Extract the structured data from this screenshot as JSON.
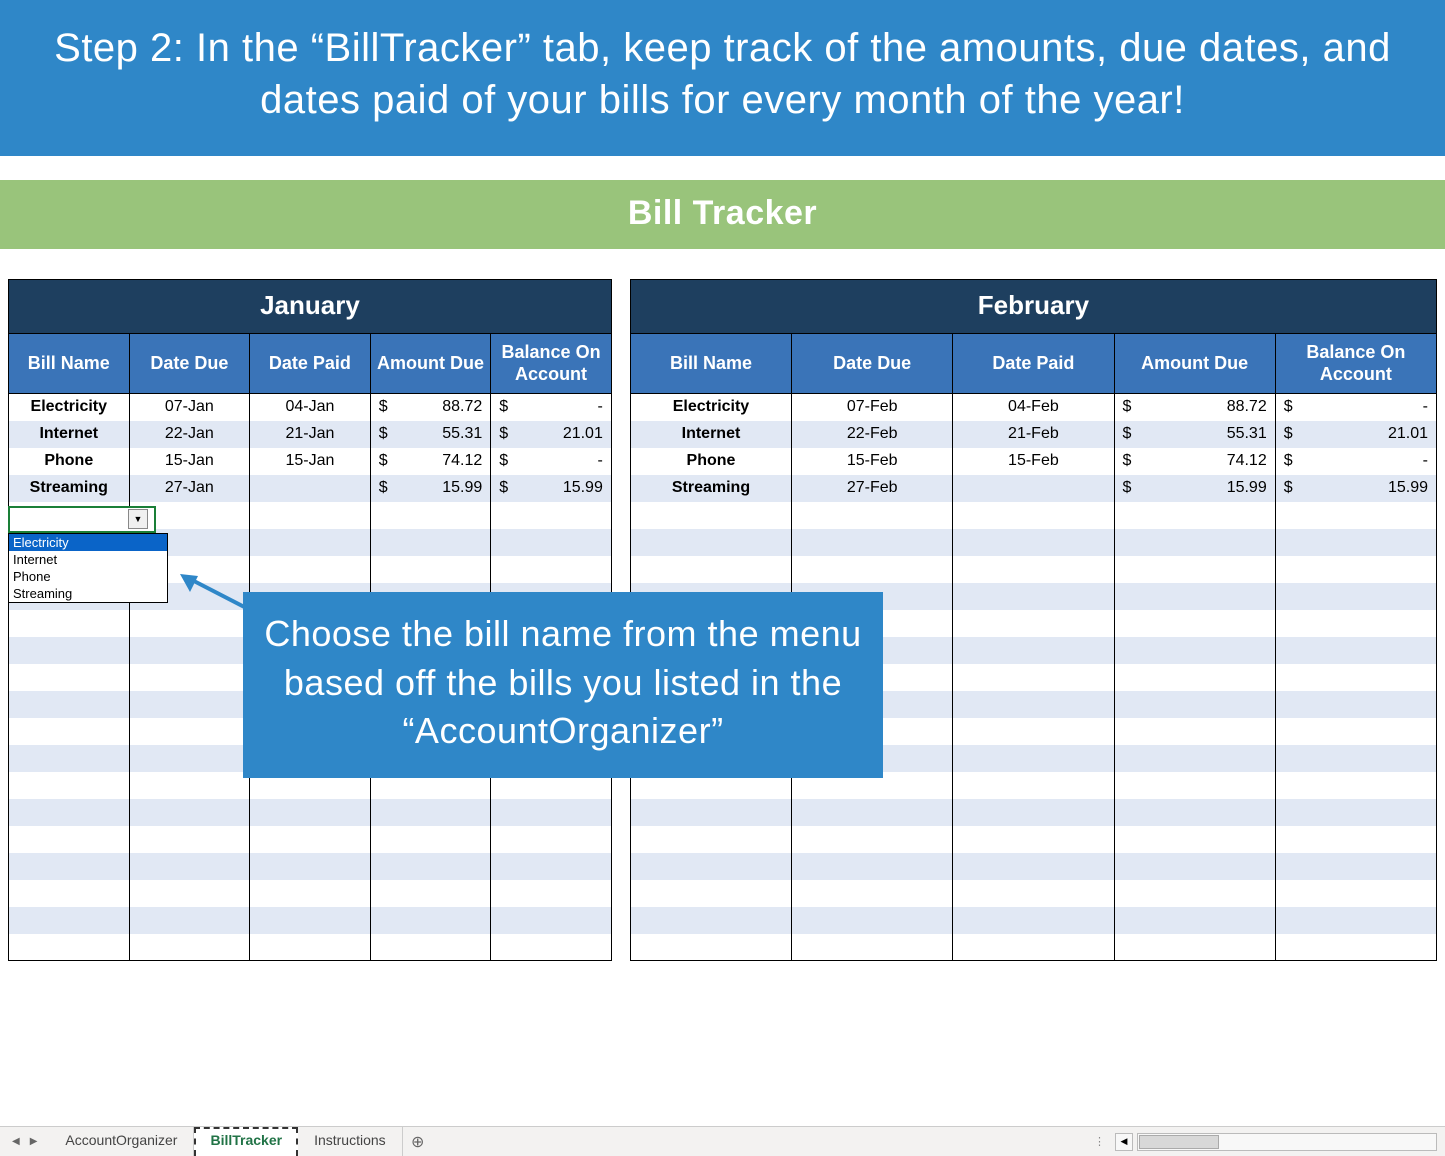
{
  "banner_top": "Step 2: In the “BillTracker” tab, keep track of the amounts, due dates, and dates paid of your bills for every month of the year!",
  "banner_green": "Bill Tracker",
  "columns": [
    "Bill Name",
    "Date Due",
    "Date Paid",
    "Amount Due",
    "Balance On Account"
  ],
  "months": [
    {
      "name": "January",
      "rows": [
        {
          "bill": "Electricity",
          "due": "07-Jan",
          "paid": "04-Jan",
          "amount": "88.72",
          "balance": "-"
        },
        {
          "bill": "Internet",
          "due": "22-Jan",
          "paid": "21-Jan",
          "amount": "55.31",
          "balance": "21.01"
        },
        {
          "bill": "Phone",
          "due": "15-Jan",
          "paid": "15-Jan",
          "amount": "74.12",
          "balance": "-"
        },
        {
          "bill": "Streaming",
          "due": "27-Jan",
          "paid": "",
          "amount": "15.99",
          "balance": "15.99"
        }
      ],
      "blank_rows": 17
    },
    {
      "name": "February",
      "rows": [
        {
          "bill": "Electricity",
          "due": "07-Feb",
          "paid": "04-Feb",
          "amount": "88.72",
          "balance": "-"
        },
        {
          "bill": "Internet",
          "due": "22-Feb",
          "paid": "21-Feb",
          "amount": "55.31",
          "balance": "21.01"
        },
        {
          "bill": "Phone",
          "due": "15-Feb",
          "paid": "15-Feb",
          "amount": "74.12",
          "balance": "-"
        },
        {
          "bill": "Streaming",
          "due": "27-Feb",
          "paid": "",
          "amount": "15.99",
          "balance": "15.99"
        }
      ],
      "blank_rows": 17
    }
  ],
  "dropdown": {
    "options": [
      "Electricity",
      "Internet",
      "Phone",
      "Streaming"
    ],
    "selected_index": 0
  },
  "callout": "Choose the bill name from the menu based off the bills you listed in the “AccountOrganizer”",
  "tabs": {
    "sheets": [
      "AccountOrganizer",
      "BillTracker",
      "Instructions"
    ],
    "active_index": 1
  },
  "currency": "$"
}
